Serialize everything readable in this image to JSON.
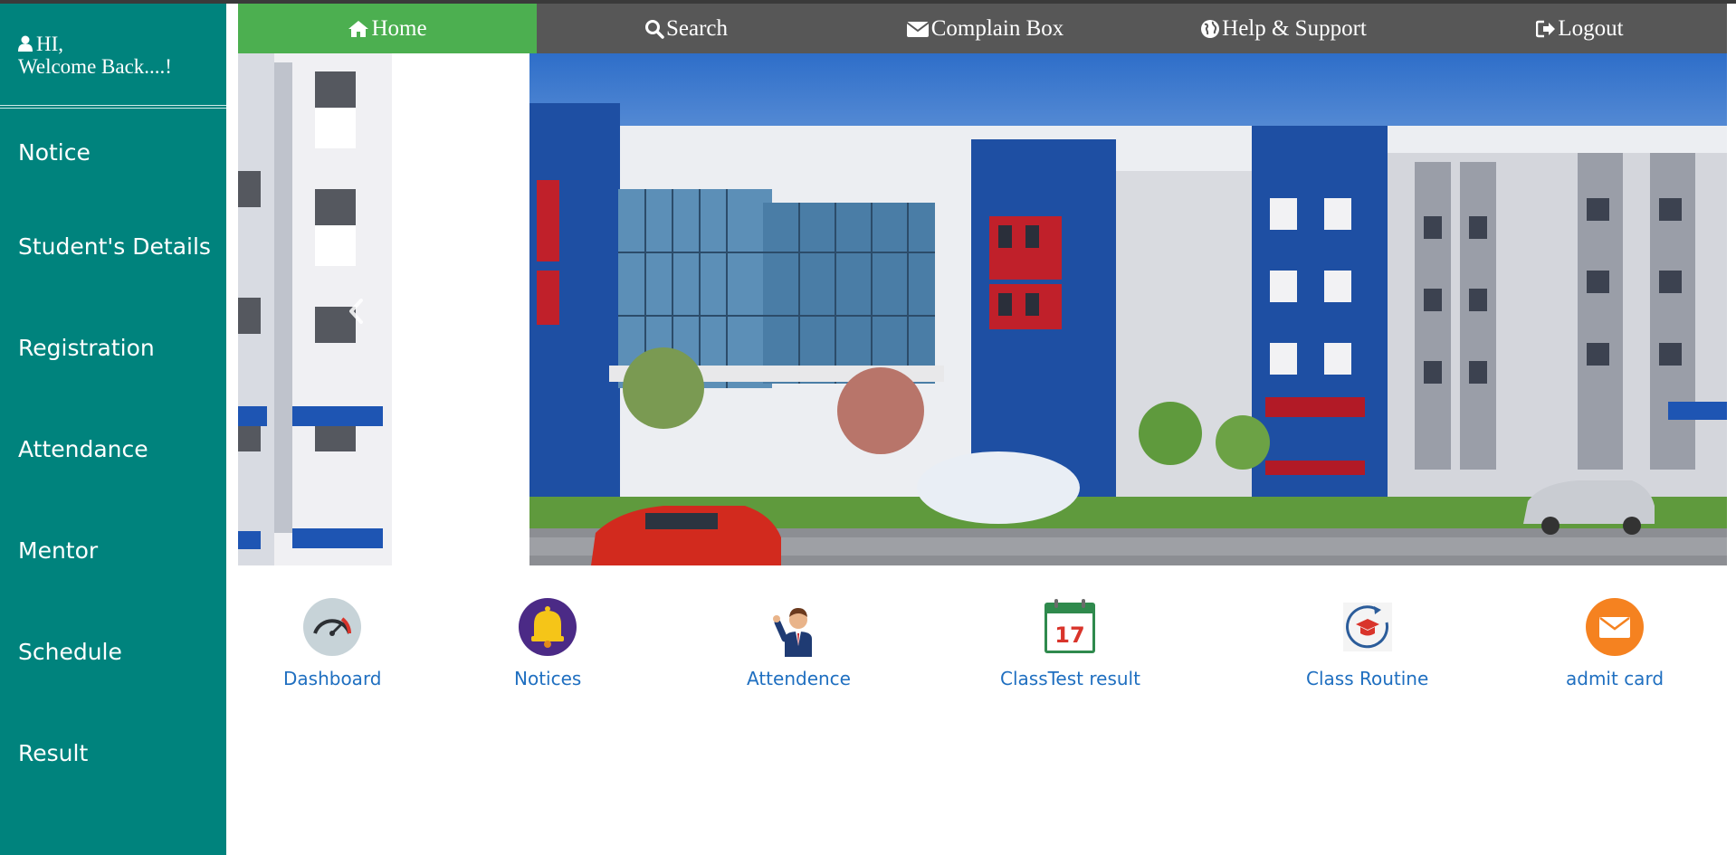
{
  "sidebar": {
    "greeting": "HI,",
    "welcome": "Welcome Back....!",
    "items": [
      {
        "label": "Notice"
      },
      {
        "label": "Student's Details"
      },
      {
        "label": "Registration"
      },
      {
        "label": "Attendance"
      },
      {
        "label": "Mentor"
      },
      {
        "label": "Schedule"
      },
      {
        "label": "Result"
      }
    ]
  },
  "nav": {
    "items": [
      {
        "label": "Home",
        "icon": "home-icon",
        "active": true
      },
      {
        "label": "Search",
        "icon": "search-icon"
      },
      {
        "label": "Complain Box",
        "icon": "envelope-icon"
      },
      {
        "label": "Help & Support",
        "icon": "globe-icon"
      },
      {
        "label": "Logout",
        "icon": "logout-icon"
      }
    ]
  },
  "carousel": {
    "prev_icon": "chevron-left-icon"
  },
  "quick_links": [
    {
      "label": "Dashboard",
      "icon": "speedometer-icon"
    },
    {
      "label": "Notices",
      "icon": "bell-icon"
    },
    {
      "label": "Attendence",
      "icon": "person-waving-icon"
    },
    {
      "label": "ClassTest result",
      "icon": "calendar-icon",
      "icon_text": "17"
    },
    {
      "label": "Class Routine",
      "icon": "graduation-cap-icon"
    },
    {
      "label": "admit card",
      "icon": "mail-icon"
    }
  ],
  "colors": {
    "sidebar": "#00837d",
    "nav": "#575757",
    "nav_active": "#4caf50",
    "link": "#1f6fc0"
  }
}
